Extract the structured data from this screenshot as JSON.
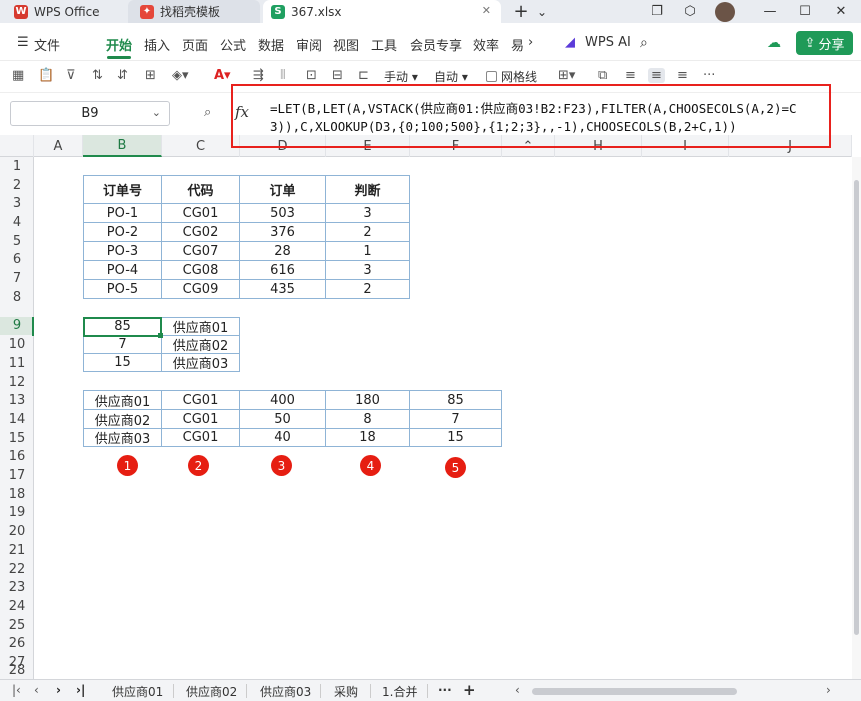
{
  "titlebar": {
    "tabs": [
      {
        "label": "WPS Office",
        "icon": "wps-logo-icon"
      },
      {
        "label": "找稻壳模板",
        "icon": "docer-icon"
      },
      {
        "label": "367.xlsx",
        "icon": "spreadsheet-icon"
      }
    ],
    "add_tab": "+",
    "dropdown": "⌄"
  },
  "menubar": {
    "items": [
      "文件",
      "开始",
      "插入",
      "页面",
      "公式",
      "数据",
      "审阅",
      "视图",
      "工具",
      "会员专享",
      "效率",
      "易"
    ],
    "active": "开始",
    "wps_ai": "WPS AI",
    "share": "分享"
  },
  "toolbar": {
    "manual": "手动",
    "auto": "自动",
    "gridlines": "网格线",
    "more": "···"
  },
  "formula_bar": {
    "cell_ref": "B9",
    "fx": "fx",
    "formula": "=LET(B,LET(A,VSTACK(供应商01:供应商03!B2:F23),FILTER(A,CHOOSECOLS(A,2)=C3)),C,XLOOKUP(D3,{0;100;500},{1;2;3},,-1),CHOOSECOLS(B,2+C,1))"
  },
  "sheet": {
    "columns": [
      "A",
      "B",
      "C",
      "D",
      "E",
      "F",
      "H",
      "I",
      "J"
    ],
    "selected_column": "B",
    "rows": [
      "1",
      "2",
      "3",
      "4",
      "5",
      "6",
      "7",
      "8",
      "9",
      "10",
      "11",
      "12",
      "13",
      "14",
      "15",
      "16",
      "17",
      "18",
      "19",
      "20",
      "21",
      "22",
      "23",
      "24",
      "25",
      "26",
      "27",
      "28"
    ],
    "selected_row": "9",
    "table1": {
      "headers": [
        "订单号",
        "代码",
        "订单",
        "判断"
      ],
      "rows": [
        [
          "PO-1",
          "CG01",
          "503",
          "3"
        ],
        [
          "PO-2",
          "CG02",
          "376",
          "2"
        ],
        [
          "PO-3",
          "CG07",
          "28",
          "1"
        ],
        [
          "PO-4",
          "CG08",
          "616",
          "3"
        ],
        [
          "PO-5",
          "CG09",
          "435",
          "2"
        ]
      ]
    },
    "table2": {
      "rows": [
        [
          "85",
          "供应商01"
        ],
        [
          "7",
          "供应商02"
        ],
        [
          "15",
          "供应商03"
        ]
      ]
    },
    "table3": {
      "rows": [
        [
          "供应商01",
          "CG01",
          "400",
          "180",
          "85"
        ],
        [
          "供应商02",
          "CG01",
          "50",
          "8",
          "7"
        ],
        [
          "供应商03",
          "CG01",
          "40",
          "18",
          "15"
        ]
      ]
    },
    "badges": [
      "1",
      "2",
      "3",
      "4",
      "5"
    ],
    "highlight_color": "#e8211d"
  },
  "sheet_tabs": {
    "tabs": [
      "供应商01",
      "供应商02",
      "供应商03",
      "采购",
      "1.合并"
    ],
    "more": "···",
    "add": "+"
  },
  "colors": {
    "accent": "#1f8a4c",
    "badge": "#e61e12",
    "table_border": "#8fb4d6"
  }
}
